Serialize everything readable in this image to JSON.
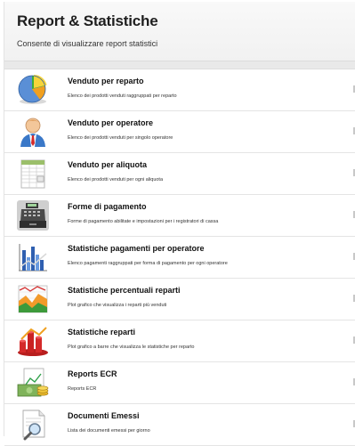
{
  "header": {
    "title": "Report & Statistiche",
    "subtitle": "Consente di visualizzare report statistici"
  },
  "items": [
    {
      "icon": "pie-chart-icon",
      "name": "Venduto per reparto",
      "desc": "Elenco dei prodotti venduti raggruppati per reparto"
    },
    {
      "icon": "operator-icon",
      "name": "Venduto per operatore",
      "desc": "Elenco dei prodotti venduti per singolo operatore"
    },
    {
      "icon": "spreadsheet-icon",
      "name": "Venduto per aliquota",
      "desc": "Elenco dei prodotti venduti per ogni aliquota"
    },
    {
      "icon": "cash-register-icon",
      "name": "Forme di pagamento",
      "desc": "Forme di pagamento abilitate e impostazioni per i registratori di cassa"
    },
    {
      "icon": "bar-chart-icon",
      "name": "Statistiche pagamenti per operatore",
      "desc": "Elenco pagamenti raggruppati per forma di pagamento per ogni operatore"
    },
    {
      "icon": "area-chart-icon",
      "name": "Statistiche percentuali reparti",
      "desc": "Plot grafico che visualizza i reparti più venduti"
    },
    {
      "icon": "3d-bar-chart-icon",
      "name": "Statistiche reparti",
      "desc": "Plot grafico a barre che visualizza le statistiche per reparto"
    },
    {
      "icon": "money-report-icon",
      "name": "Reports ECR",
      "desc": "Reports ECR"
    },
    {
      "icon": "document-search-icon",
      "name": "Documenti Emessi",
      "desc": "Lista dei documenti emessi per giorno"
    }
  ]
}
